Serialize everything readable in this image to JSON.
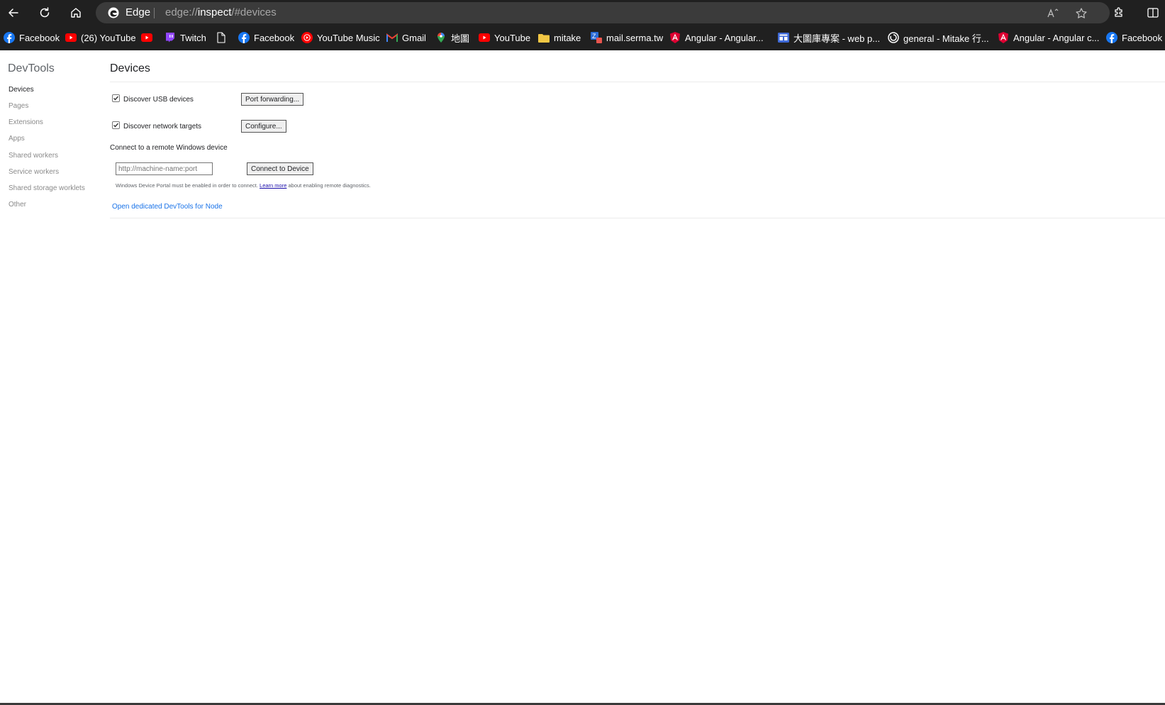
{
  "browser": {
    "brand": "Edge",
    "url_prefix": "edge://",
    "url_host": "inspect",
    "url_path": "/#devices"
  },
  "bookmarks": [
    {
      "label": "Facebook",
      "icon": "facebook-icon"
    },
    {
      "label": "(26) YouTube",
      "icon": "youtube-icon"
    },
    {
      "label": "",
      "icon": "youtube-icon"
    },
    {
      "label": "Twitch",
      "icon": "twitch-icon"
    },
    {
      "label": "",
      "icon": "page-icon"
    },
    {
      "label": "Facebook",
      "icon": "facebook-icon"
    },
    {
      "label": "YouTube Music",
      "icon": "youtube-music-icon"
    },
    {
      "label": "Gmail",
      "icon": "gmail-icon"
    },
    {
      "label": "地圖",
      "icon": "maps-icon"
    },
    {
      "label": "YouTube",
      "icon": "youtube-icon"
    },
    {
      "label": "mitake",
      "icon": "folder-icon"
    },
    {
      "label": "mail.serma.tw",
      "icon": "mail-icon"
    },
    {
      "label": "Angular - Angular...",
      "icon": "angular-icon"
    },
    {
      "label": "大圖庫專案 - web p...",
      "icon": "board-icon"
    },
    {
      "label": "general - Mitake 行...",
      "icon": "circle-icon"
    },
    {
      "label": "Angular - Angular c...",
      "icon": "angular-icon"
    },
    {
      "label": "Facebook",
      "icon": "facebook-icon"
    }
  ],
  "sidebar": {
    "title": "DevTools",
    "items": [
      {
        "label": "Devices",
        "active": true
      },
      {
        "label": "Pages"
      },
      {
        "label": "Extensions"
      },
      {
        "label": "Apps"
      },
      {
        "label": "Shared workers"
      },
      {
        "label": "Service workers"
      },
      {
        "label": "Shared storage worklets"
      },
      {
        "label": "Other"
      }
    ]
  },
  "main": {
    "title": "Devices",
    "usb": {
      "label": "Discover USB devices",
      "checked": true,
      "button": "Port forwarding..."
    },
    "network": {
      "label": "Discover network targets",
      "checked": true,
      "button": "Configure..."
    },
    "remote_label": "Connect to a remote Windows device",
    "remote_input_placeholder": "http://machine-name:port",
    "connect_button": "Connect to Device",
    "note_before": "Windows Device Portal must be enabled in order to connect.",
    "note_link": "Learn more",
    "note_after": "about enabling remote diagnostics.",
    "node_link": "Open dedicated DevTools for Node"
  }
}
